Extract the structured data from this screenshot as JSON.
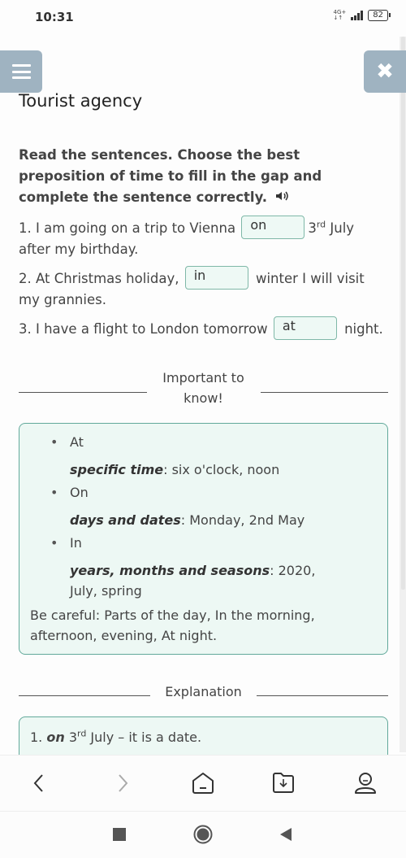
{
  "status_bar": {
    "time": "10:31",
    "network": "4G+",
    "battery": "82"
  },
  "header": {
    "menu_icon": "hamburger-menu-icon",
    "close_icon": "close-icon",
    "close_glyph": "✖",
    "title": "Tourist agency"
  },
  "exercise": {
    "instructions": "Read the sentences. Choose the best preposition of time to fill in the gap and complete the sentence correctly.",
    "audio_icon": "speaker-icon",
    "audio_glyph": "◀)",
    "sentences": [
      {
        "before": "1. I am going on a trip to Vienna",
        "answer": "on",
        "after_num": "3",
        "after_sup": "rd",
        "after": " July after my birthday."
      },
      {
        "before": "2. At Christmas holiday,",
        "answer": "in",
        "after": " winter I will visit my grannies."
      },
      {
        "before": "3. I have a flight to London tomorrow",
        "answer": "at",
        "after": " night."
      }
    ]
  },
  "important": {
    "heading": "Important to know!",
    "items": [
      {
        "preposition": "At",
        "term": "specific time",
        "examples": ": six o'clock, noon"
      },
      {
        "preposition": "On",
        "term": "days and dates",
        "examples": ": Monday, 2nd May"
      },
      {
        "preposition": "In",
        "term": "years, months and seasons",
        "examples": ": 2020, July, spring"
      }
    ],
    "be_careful": "Be careful: Parts of the day, In the morning, afternoon, evening, At night."
  },
  "explanation": {
    "heading": "Explanation",
    "lines": [
      {
        "prefix": "1. ",
        "prep": "on",
        "num": " 3",
        "sup": "rd",
        "rest": " July – it is a date."
      }
    ]
  },
  "bottom_nav": {
    "items": [
      "back-icon",
      "forward-icon",
      "home-icon",
      "downloads-folder-icon",
      "profile-icon"
    ]
  },
  "system_nav": {
    "items": [
      "recents-icon",
      "home-circle-icon",
      "back-triangle-icon"
    ]
  },
  "colors": {
    "accent_border": "#62a99b",
    "callout_bg": "#edf8f4",
    "header_button_bg": "#9fb3c1"
  }
}
